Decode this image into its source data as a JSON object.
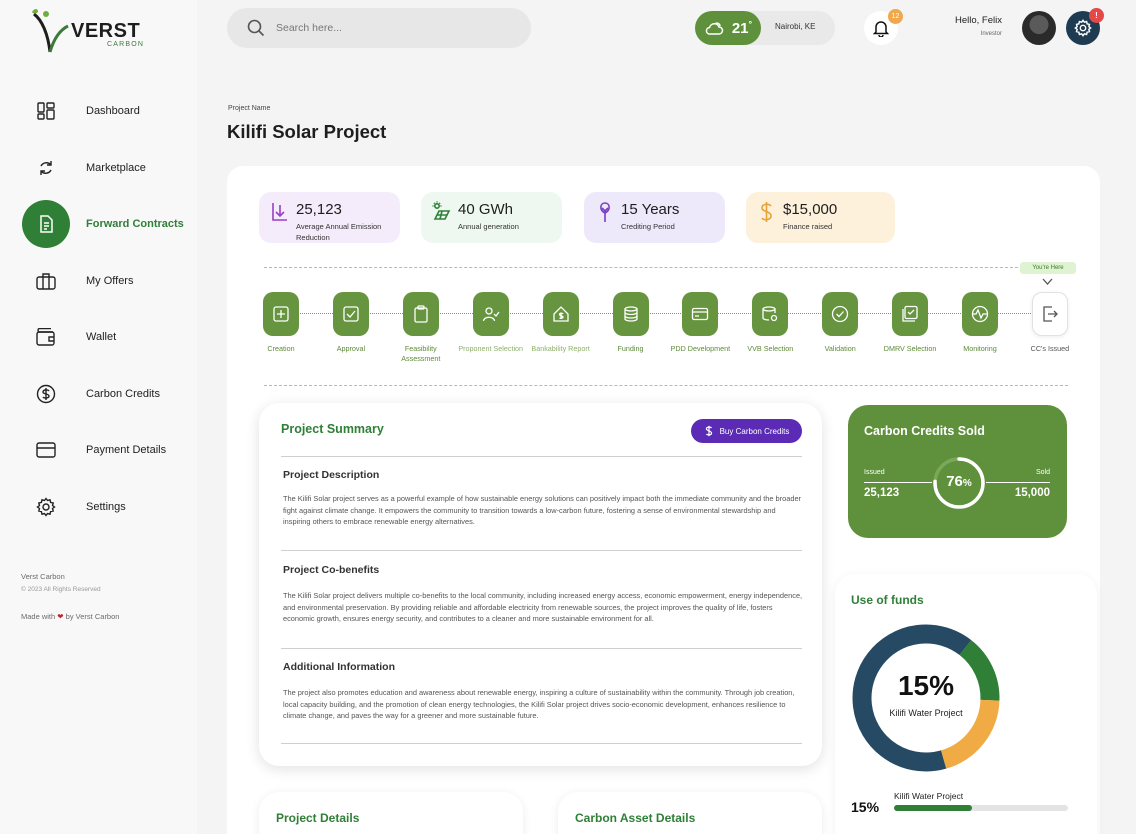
{
  "brand": {
    "name": "VERST",
    "sub": "CARBON"
  },
  "sidebar": {
    "items": [
      {
        "label": "Dashboard",
        "icon": "dashboard-icon"
      },
      {
        "label": "Marketplace",
        "icon": "refresh-icon"
      },
      {
        "label": "Forward Contracts",
        "icon": "document-icon",
        "active": true
      },
      {
        "label": "My Offers",
        "icon": "briefcase-icon"
      },
      {
        "label": "Wallet",
        "icon": "wallet-icon"
      },
      {
        "label": "Carbon Credits",
        "icon": "dollar-circle-icon"
      },
      {
        "label": "Payment Details",
        "icon": "card-icon"
      },
      {
        "label": "Settings",
        "icon": "gear-icon"
      }
    ],
    "footer_company": "Verst Carbon",
    "footer_rights": "© 2023 All Rights Reserved",
    "footer_made_prefix": "Made with",
    "footer_made_suffix": "by Verst Carbon"
  },
  "header": {
    "search_placeholder": "Search here...",
    "weather_temp": "21",
    "weather_degree": "°",
    "weather_location": "Nairobi, KE",
    "notifications_count": "12",
    "greeting": "Hello, Felix",
    "role": "Investor",
    "settings_badge": "!"
  },
  "project": {
    "label": "Project Name",
    "title": "Kilifi Solar Project"
  },
  "stats": [
    {
      "value": "25,123",
      "label": "Average Annual Emission Reduction",
      "bg": "#f4ecfa",
      "icon": "download-icon",
      "color": "#9b3fc4"
    },
    {
      "value": "40 GWh",
      "label": "Annual generation",
      "bg": "#eef8f1",
      "icon": "solar-panel-icon",
      "color": "#2f7f37"
    },
    {
      "value": "15 Years",
      "label": "Crediting Period",
      "bg": "#ede9fa",
      "icon": "tree-icon",
      "color": "#7a3fc4"
    },
    {
      "value": "$15,000",
      "label": "Finance raised",
      "bg": "#fdf1dc",
      "icon": "dollar-icon",
      "color": "#e8a338"
    }
  ],
  "stepper": {
    "you_are_here": "You're Here",
    "steps": [
      {
        "label": "Creation",
        "icon": "plus-square-icon"
      },
      {
        "label": "Approval",
        "icon": "check-square-icon"
      },
      {
        "label": "Feasibility Assessment",
        "icon": "clipboard-icon"
      },
      {
        "label": "Proponent Selection",
        "icon": "user-check-icon"
      },
      {
        "label": "Bankability Report",
        "icon": "house-dollar-icon"
      },
      {
        "label": "Funding",
        "icon": "coins-icon"
      },
      {
        "label": "PDD Development",
        "icon": "card-icon"
      },
      {
        "label": "VVB Selection",
        "icon": "database-settings-icon"
      },
      {
        "label": "Validation",
        "icon": "check-circle-icon"
      },
      {
        "label": "DMRV Selection",
        "icon": "tasks-icon"
      },
      {
        "label": "Monitoring",
        "icon": "monitor-heart-icon"
      },
      {
        "label": "CC's Issued",
        "icon": "export-icon"
      }
    ]
  },
  "summary": {
    "title": "Project Summary",
    "buy_label": "Buy Carbon Credits",
    "sections": [
      {
        "heading": "Project Description",
        "text": "The Kilifi Solar project serves as a powerful example of how sustainable energy solutions can positively impact both the immediate community and the broader fight against climate change. It empowers the community to transition towards a low-carbon future, fostering a sense of environmental stewardship and inspiring others to embrace renewable energy alternatives."
      },
      {
        "heading": "Project Co-benefits",
        "text": "The Kilifi Solar project delivers multiple co-benefits to the local community, including increased energy access, economic empowerment, energy independence, and environmental preservation. By providing reliable and affordable electricity from renewable sources, the project improves the quality of life, fosters economic growth, ensures energy security, and contributes to a cleaner and more sustainable environment for all."
      },
      {
        "heading": "Additional Information",
        "text": "The project also promotes education and awareness about renewable energy, inspiring a culture of sustainability within the community. Through job creation, local capacity building, and the promotion of clean energy technologies, the Kilifi Solar project drives socio-economic development, enhances resilience to climate change, and paves the way for a greener and more sustainable future."
      }
    ]
  },
  "credits_sold": {
    "title": "Carbon Credits Sold",
    "issued_label": "Issued",
    "issued_value": "25,123",
    "sold_label": "Sold",
    "sold_value": "15,000",
    "percent": "76",
    "percent_sign": "%",
    "fraction": 0.76
  },
  "funds": {
    "title": "Use of funds",
    "center_pct": "15%",
    "center_label": "Kilifi Water Project",
    "segments": [
      {
        "name": "Kilifi Water Project",
        "fraction": 0.15,
        "color": "#2f7f37"
      },
      {
        "name": "",
        "fraction": 0.2,
        "color": "#f0ab45"
      },
      {
        "name": "",
        "fraction": 0.65,
        "color": "#264a63"
      }
    ],
    "legend": [
      {
        "pct": "15%",
        "name": "Kilifi Water Project",
        "fraction": 0.45
      }
    ]
  },
  "bottom_cards": {
    "project_details": "Project Details",
    "carbon_asset": "Carbon Asset Details"
  }
}
